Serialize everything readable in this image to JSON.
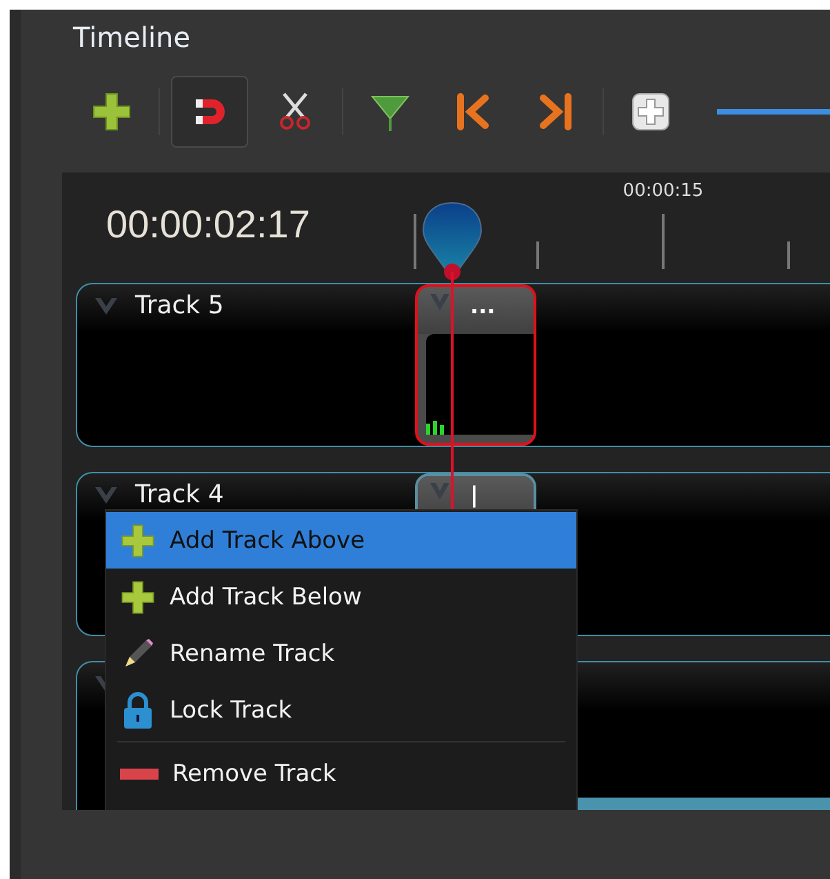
{
  "title": "Timeline",
  "toolbar": [
    {
      "kind": "add",
      "selected": false
    },
    {
      "kind": "snap",
      "selected": true
    },
    {
      "kind": "razor",
      "selected": false
    },
    {
      "kind": "marker",
      "selected": false
    },
    {
      "kind": "previous",
      "selected": false
    },
    {
      "kind": "next",
      "selected": false
    },
    {
      "kind": "zoom",
      "selected": false
    }
  ],
  "timecode": "00:00:02:17",
  "ruler": {
    "labels": [
      "00:00:15"
    ]
  },
  "tracks": [
    {
      "name": "Track 5",
      "clip": {
        "label": "...",
        "selected": true
      }
    },
    {
      "name": "Track 4",
      "clip": {
        "label": "|",
        "selected": false
      }
    }
  ],
  "context_menu": [
    {
      "label": "Add Track Above",
      "kind": "add",
      "selected": true,
      "separator_before": false
    },
    {
      "label": "Add Track Below",
      "kind": "add",
      "selected": false,
      "separator_before": false
    },
    {
      "label": "Rename Track",
      "kind": "rename",
      "selected": false,
      "separator_before": false
    },
    {
      "label": "Lock Track",
      "kind": "lock",
      "selected": false,
      "separator_before": false
    },
    {
      "label": "Remove Track",
      "kind": "remove",
      "selected": false,
      "separator_before": true
    }
  ]
}
